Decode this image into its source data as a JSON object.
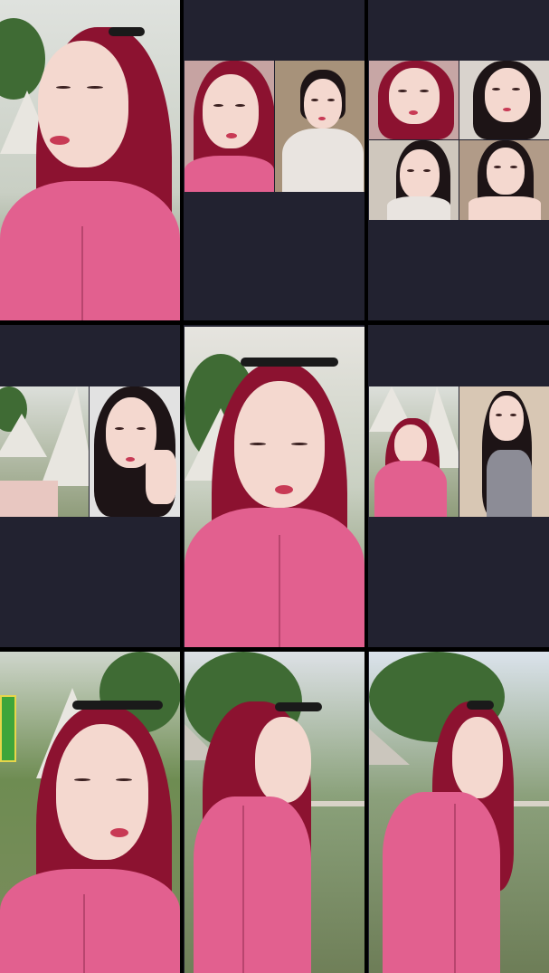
{
  "screen": {
    "description_free": true,
    "background_color": "#000000",
    "empty_cell_color": "#222230"
  },
  "grid": {
    "rows": 3,
    "columns": 3,
    "cells": [
      {
        "id": "r1c1",
        "content": "single-portrait",
        "scene": "outdoor-tent"
      },
      {
        "id": "r1c2",
        "content": "two-person-split",
        "scene": "indoor"
      },
      {
        "id": "r1c3",
        "content": "four-person-split",
        "scene": "indoor"
      },
      {
        "id": "r2c1",
        "content": "two-person-split",
        "scene": "outdoor-tent"
      },
      {
        "id": "r2c2",
        "content": "single-portrait",
        "scene": "outdoor-tent"
      },
      {
        "id": "r2c3",
        "content": "two-person-split",
        "scene": "outdoor-tent"
      },
      {
        "id": "r3c1",
        "content": "single-portrait",
        "scene": "outdoor-park"
      },
      {
        "id": "r3c2",
        "content": "single-portrait",
        "scene": "outdoor-park"
      },
      {
        "id": "r3c3",
        "content": "single-portrait",
        "scene": "outdoor-park"
      }
    ]
  },
  "colors": {
    "hoodie_pink": "#e2608f",
    "hair_red": "#8c1230",
    "hair_dark": "#1d1416",
    "skin": "#f4d8cf",
    "tent_white": "#e8e6e0",
    "foliage_green": "#3f6b34"
  }
}
